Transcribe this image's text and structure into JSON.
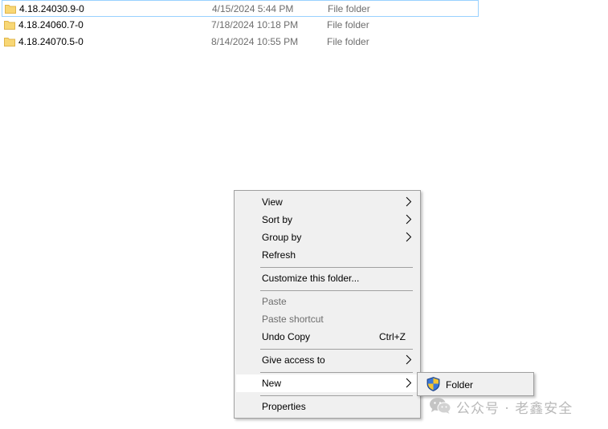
{
  "files": [
    {
      "name": "4.18.24030.9-0",
      "date": "4/15/2024 5:44 PM",
      "type": "File folder"
    },
    {
      "name": "4.18.24060.7-0",
      "date": "7/18/2024 10:18 PM",
      "type": "File folder"
    },
    {
      "name": "4.18.24070.5-0",
      "date": "8/14/2024 10:55 PM",
      "type": "File folder"
    }
  ],
  "context_menu": {
    "view": "View",
    "sort_by": "Sort by",
    "group_by": "Group by",
    "refresh": "Refresh",
    "customize": "Customize this folder...",
    "paste": "Paste",
    "paste_shortcut": "Paste shortcut",
    "undo_copy": "Undo Copy",
    "undo_copy_shortcut": "Ctrl+Z",
    "give_access": "Give access to",
    "new": "New",
    "properties": "Properties"
  },
  "submenu": {
    "folder": "Folder"
  },
  "watermark": {
    "text": "公众号 · 老鑫安全"
  },
  "colors": {
    "folder_yellow": "#f8d775",
    "folder_dark": "#e0b54a",
    "focus_border": "#99d1ff",
    "menu_bg": "#f0f0f0",
    "disabled_text": "#6d6d6d",
    "watermark": "#b9b9b9"
  },
  "icons": {
    "folder": "folder-icon",
    "arrow": "chevron-right-icon",
    "shield": "uac-shield-icon",
    "wechat": "wechat-icon"
  }
}
